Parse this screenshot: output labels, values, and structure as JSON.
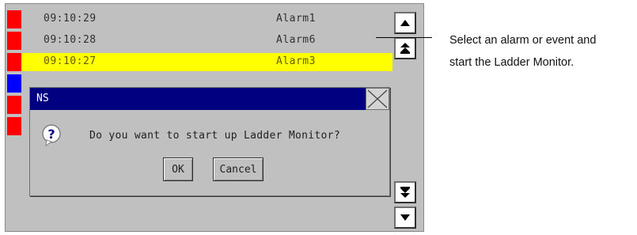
{
  "alarm_list": {
    "rows": [
      {
        "time": "09:10:29",
        "alarm": "Alarm1",
        "marker_color": "#ff0000",
        "selected": false
      },
      {
        "time": "09:10:28",
        "alarm": "Alarm6",
        "marker_color": "#ff0000",
        "selected": false
      },
      {
        "time": "09:10:27",
        "alarm": "Alarm3",
        "marker_color": "#ff0000",
        "selected": true
      },
      {
        "time": "",
        "alarm": "",
        "marker_color": "#0000ff",
        "selected": false
      },
      {
        "time": "",
        "alarm": "",
        "marker_color": "#ff0000",
        "selected": false
      },
      {
        "time": "",
        "alarm": "",
        "marker_color": "#ff0000",
        "selected": false
      }
    ],
    "highlight_color": "#ffff00"
  },
  "scroll_buttons": {
    "up": "scroll-up-icon",
    "page_up": "page-up-icon",
    "page_down": "page-down-icon",
    "down": "scroll-down-icon"
  },
  "dialog": {
    "title": "NS",
    "message": "Do you want to start up Ladder Monitor?",
    "ok_label": "OK",
    "cancel_label": "Cancel",
    "icon": "question-icon",
    "titlebar_color": "#000080"
  },
  "callout": {
    "line1": "Select an alarm or event and",
    "line2": "start the Ladder Monitor."
  }
}
